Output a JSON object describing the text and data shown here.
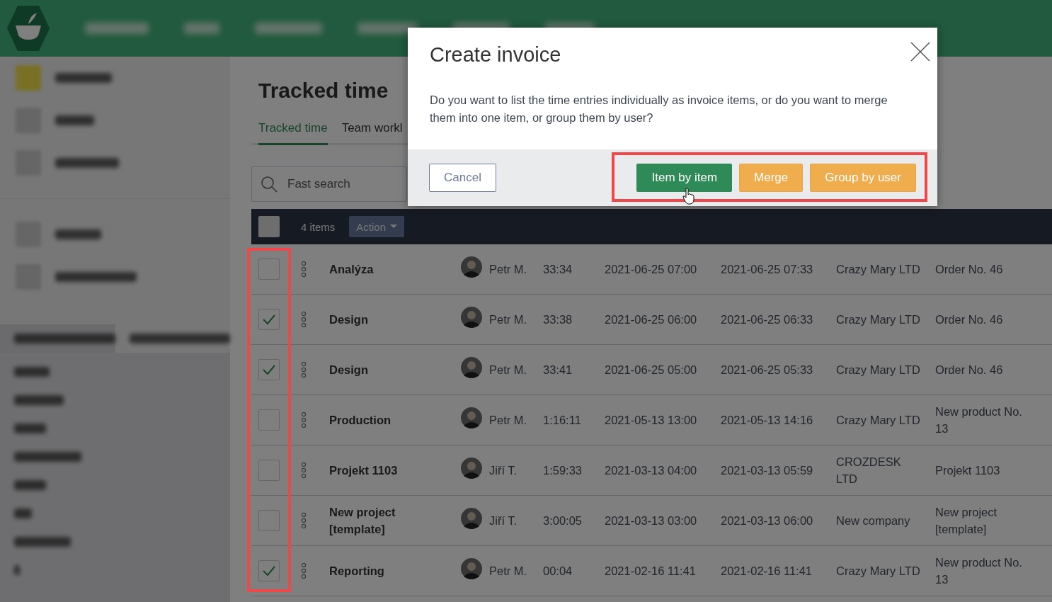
{
  "page": {
    "title": "Tracked time",
    "tabs": [
      {
        "label": "Tracked time",
        "selected": true
      },
      {
        "label": "Team workl",
        "selected": false
      }
    ],
    "search": {
      "placeholder": "Fast search"
    }
  },
  "table": {
    "toolbar": {
      "checked": false,
      "count": "4 items",
      "action": "Action"
    },
    "rows": [
      {
        "checked": false,
        "name": "Analýza",
        "user": "Petr M.",
        "duration": "33:34",
        "start": "2021-06-25 07:00",
        "end": "2021-06-25 07:33",
        "company": "Crazy Mary LTD",
        "project": "Order No. 46"
      },
      {
        "checked": true,
        "name": "Design",
        "user": "Petr M.",
        "duration": "33:38",
        "start": "2021-06-25 06:00",
        "end": "2021-06-25 06:33",
        "company": "Crazy Mary LTD",
        "project": "Order No. 46"
      },
      {
        "checked": true,
        "name": "Design",
        "user": "Petr M.",
        "duration": "33:41",
        "start": "2021-06-25 05:00",
        "end": "2021-06-25 05:33",
        "company": "Crazy Mary LTD",
        "project": "Order No. 46"
      },
      {
        "checked": false,
        "name": "Production",
        "user": "Petr M.",
        "duration": "1:16:11",
        "start": "2021-05-13 13:00",
        "end": "2021-05-13 14:16",
        "company": "Crazy Mary LTD",
        "project": "New product No. 13"
      },
      {
        "checked": false,
        "name": "Projekt 1103",
        "user": "Jiří T.",
        "duration": "1:59:33",
        "start": "2021-03-13 04:00",
        "end": "2021-03-13 05:59",
        "company": "CROZDESK LTD",
        "project": "Projekt 1103"
      },
      {
        "checked": false,
        "name": "New project [template]",
        "user": "Jiří T.",
        "duration": "3:00:05",
        "start": "2021-03-13 03:00",
        "end": "2021-03-13 06:00",
        "company": "New company",
        "project": "New project [template]"
      },
      {
        "checked": true,
        "name": "Reporting",
        "user": "Petr M.",
        "duration": "00:04",
        "start": "2021-02-16 11:41",
        "end": "2021-02-16 11:41",
        "company": "Crazy Mary LTD",
        "project": "New product No. 13"
      }
    ]
  },
  "dialog": {
    "title": "Create invoice",
    "message": "Do you want to list the time entries individually as invoice items, or do you want to merge them into one item, or group them by user?",
    "buttons": [
      {
        "label": "Cancel",
        "kind": "secondary"
      },
      {
        "label": "Item by item",
        "kind": "primary"
      },
      {
        "label": "Merge",
        "kind": "warning"
      },
      {
        "label": "Group by user",
        "kind": "warning"
      }
    ]
  }
}
